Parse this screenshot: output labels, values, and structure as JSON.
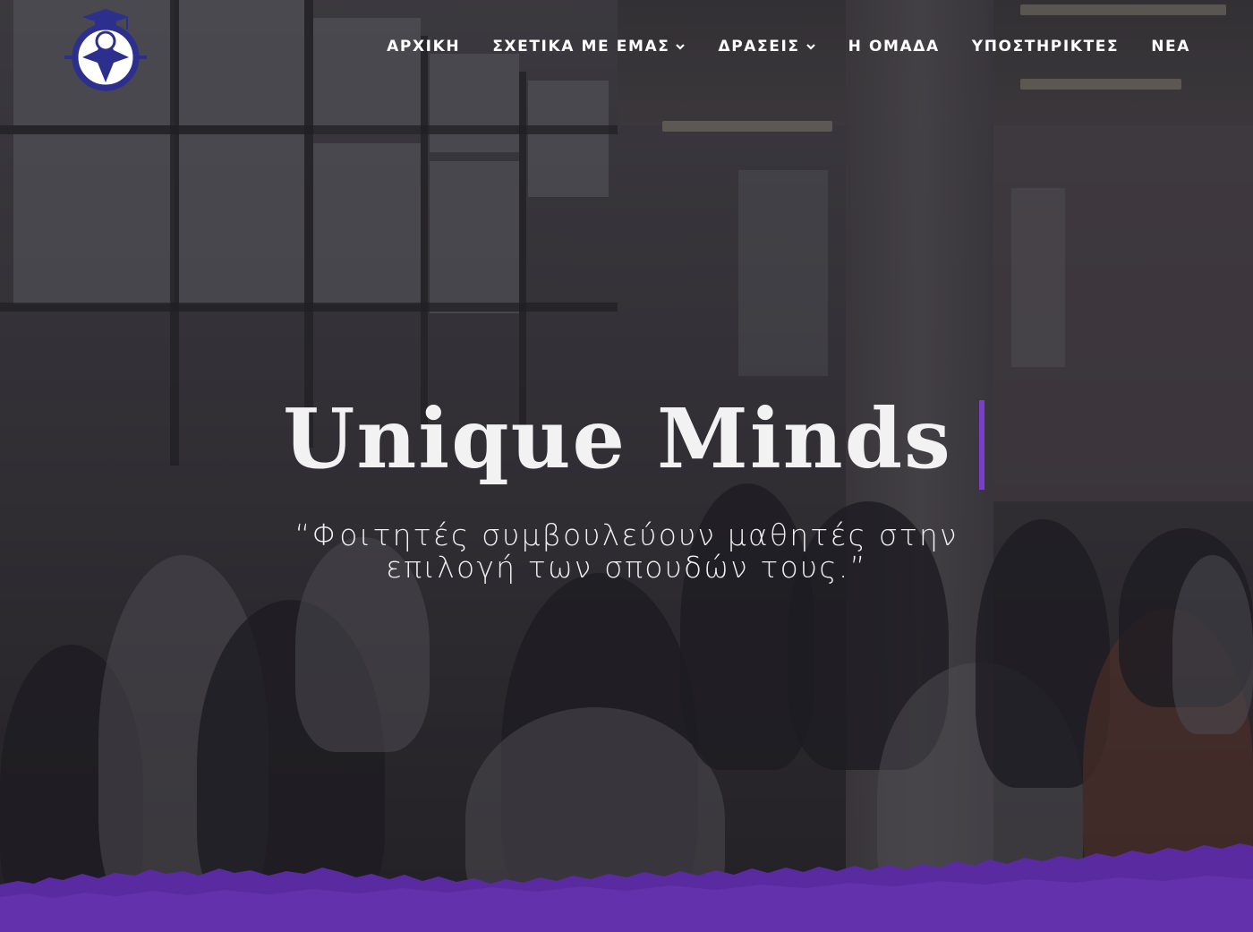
{
  "header": {
    "logo_icon": "graduation-compass-logo",
    "nav": [
      {
        "label": "ΑΡΧΙΚΗ",
        "has_dropdown": false
      },
      {
        "label": "ΣΧΕΤΙΚΑ ΜΕ ΕΜΑΣ",
        "has_dropdown": true
      },
      {
        "label": "ΔΡΑΣΕΙΣ",
        "has_dropdown": true
      },
      {
        "label": "Η ΟΜΑΔΑ",
        "has_dropdown": false
      },
      {
        "label": "ΥΠΟΣΤΗΡΙΚΤΕΣ",
        "has_dropdown": false
      },
      {
        "label": "ΝΕΑ",
        "has_dropdown": false
      }
    ]
  },
  "hero": {
    "title": "Unique Minds",
    "subtitle_line1": "“Φοιτητές συμβουλεύουν μαθητές στην",
    "subtitle_line2": "επιλογή των σπουδών τους.”"
  },
  "colors": {
    "accent": "#5a2aa0",
    "cursor": "#7a3fc9",
    "logo_blue": "#2d2f8f",
    "text": "#ffffff"
  }
}
